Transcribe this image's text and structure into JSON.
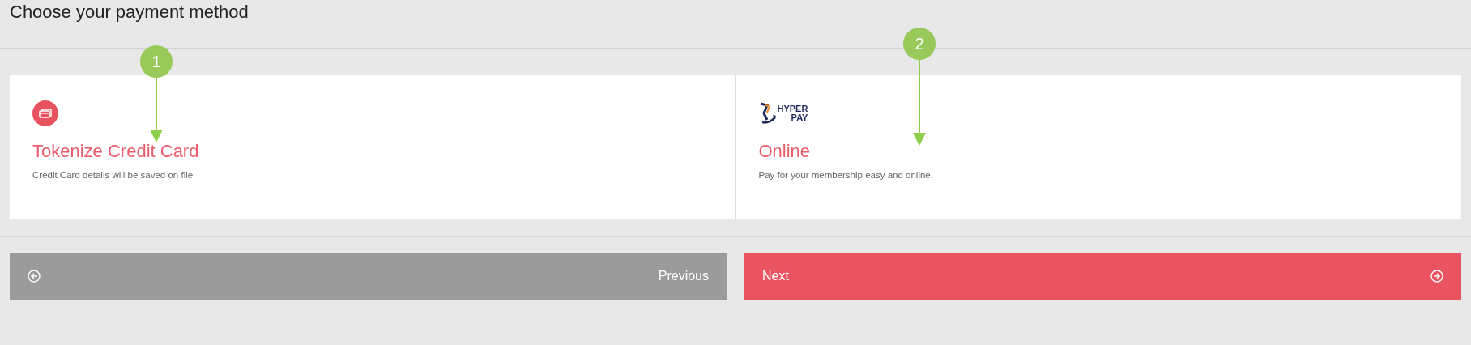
{
  "heading": "Choose your payment method",
  "methods": [
    {
      "kind": "card",
      "title": "Tokenize Credit Card",
      "description": "Credit Card details will be saved on file"
    },
    {
      "kind": "hyperpay",
      "logo_text": [
        "HYPER",
        "PAY"
      ],
      "title": "Online",
      "description": "Pay for your membership easy and online."
    }
  ],
  "buttons": [
    {
      "kind": "previous",
      "label": "Previous"
    },
    {
      "kind": "next",
      "label": "Next"
    }
  ],
  "annotations": [
    {
      "label": "1"
    },
    {
      "label": "2"
    }
  ]
}
